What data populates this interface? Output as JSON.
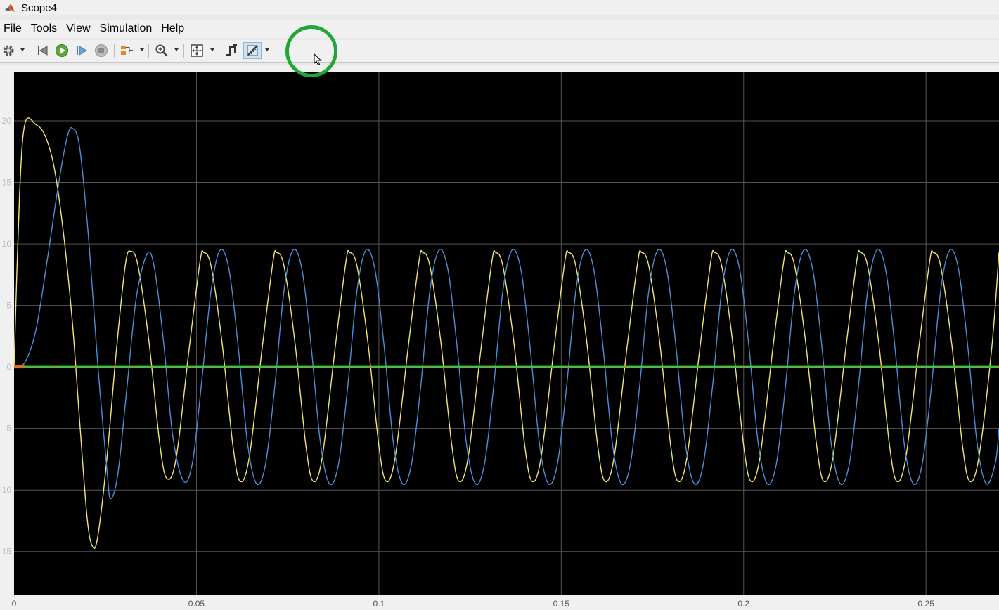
{
  "window": {
    "title": "Scope4"
  },
  "menu": [
    "File",
    "Tools",
    "View",
    "Simulation",
    "Help"
  ],
  "toolbar": {
    "buttons": [
      "settings",
      "step-back",
      "run",
      "step-forward",
      "stop",
      "signal-layout",
      "zoom",
      "fit-to-view",
      "triggers",
      "measurements"
    ]
  },
  "chart_data": {
    "type": "line",
    "background": "#000000",
    "grid": true,
    "xlim": [
      0,
      0.27
    ],
    "ylim": [
      -18.5,
      24
    ],
    "x_ticks": [
      0,
      0.05,
      0.1,
      0.15,
      0.2,
      0.25
    ],
    "x_tick_labels": [
      "0",
      "0.05",
      "0.1",
      "0.15",
      "0.2",
      "0.25"
    ],
    "y_ticks": [
      20,
      15,
      10,
      5,
      0,
      -5,
      -10,
      -15
    ],
    "y_tick_labels": [
      "20",
      "15",
      "10",
      "5",
      "0",
      "-5",
      "-10",
      "-15"
    ],
    "series": [
      {
        "color": "#f2e66e",
        "points": [
          [
            0,
            0
          ],
          [
            0.0015,
            14
          ],
          [
            0.003,
            19.8
          ],
          [
            0.006,
            19.7
          ],
          [
            0.0085,
            18.8
          ],
          [
            0.011,
            16.2
          ],
          [
            0.0135,
            11
          ],
          [
            0.016,
            3.6
          ],
          [
            0.018,
            -4.5
          ],
          [
            0.02,
            -12.2
          ],
          [
            0.0215,
            -14.6
          ],
          [
            0.023,
            -13.7
          ],
          [
            0.0255,
            -7.3
          ],
          [
            0.028,
            1.2
          ],
          [
            0.0305,
            8.3
          ],
          [
            0.032,
            9.4
          ],
          [
            0.034,
            8.2
          ],
          [
            0.037,
            2
          ],
          [
            0.04,
            -6.4
          ],
          [
            0.042,
            -9.1
          ],
          [
            0.0445,
            -7.3
          ],
          [
            0.048,
            1.5
          ],
          [
            0.051,
            8.6
          ],
          [
            0.052,
            9.3
          ],
          [
            0.054,
            8.2
          ],
          [
            0.057,
            2
          ],
          [
            0.06,
            -6.4
          ],
          [
            0.062,
            -9.3
          ],
          [
            0.0645,
            -7.3
          ],
          [
            0.068,
            1.5
          ],
          [
            0.071,
            8.6
          ],
          [
            0.072,
            9.3
          ],
          [
            0.074,
            8.2
          ],
          [
            0.077,
            2
          ],
          [
            0.08,
            -6.4
          ],
          [
            0.082,
            -9.3
          ],
          [
            0.0845,
            -7.3
          ],
          [
            0.088,
            1.5
          ],
          [
            0.091,
            8.6
          ],
          [
            0.092,
            9.3
          ],
          [
            0.094,
            8.2
          ],
          [
            0.097,
            2
          ],
          [
            0.1,
            -6.4
          ],
          [
            0.102,
            -9.3
          ],
          [
            0.1045,
            -7.3
          ],
          [
            0.108,
            1.5
          ],
          [
            0.111,
            8.6
          ],
          [
            0.112,
            9.3
          ],
          [
            0.114,
            8.2
          ],
          [
            0.117,
            2
          ],
          [
            0.12,
            -6.4
          ],
          [
            0.122,
            -9.3
          ],
          [
            0.1245,
            -7.3
          ],
          [
            0.128,
            1.5
          ],
          [
            0.131,
            8.6
          ],
          [
            0.132,
            9.3
          ],
          [
            0.134,
            8.2
          ],
          [
            0.137,
            2
          ],
          [
            0.14,
            -6.4
          ],
          [
            0.142,
            -9.3
          ],
          [
            0.1445,
            -7.3
          ],
          [
            0.148,
            1.5
          ],
          [
            0.151,
            8.6
          ],
          [
            0.152,
            9.3
          ],
          [
            0.154,
            8.2
          ],
          [
            0.157,
            2
          ],
          [
            0.16,
            -6.4
          ],
          [
            0.162,
            -9.3
          ],
          [
            0.1645,
            -7.3
          ],
          [
            0.168,
            1.5
          ],
          [
            0.171,
            8.6
          ],
          [
            0.172,
            9.3
          ],
          [
            0.174,
            8.2
          ],
          [
            0.177,
            2
          ],
          [
            0.18,
            -6.4
          ],
          [
            0.182,
            -9.3
          ],
          [
            0.1845,
            -7.3
          ],
          [
            0.188,
            1.5
          ],
          [
            0.191,
            8.6
          ],
          [
            0.192,
            9.3
          ],
          [
            0.194,
            8.2
          ],
          [
            0.197,
            2
          ],
          [
            0.2,
            -6.4
          ],
          [
            0.202,
            -9.3
          ],
          [
            0.2045,
            -7.3
          ],
          [
            0.208,
            1.5
          ],
          [
            0.211,
            8.6
          ],
          [
            0.212,
            9.3
          ],
          [
            0.214,
            8.2
          ],
          [
            0.217,
            2
          ],
          [
            0.22,
            -6.4
          ],
          [
            0.222,
            -9.3
          ],
          [
            0.2245,
            -7.3
          ],
          [
            0.228,
            1.5
          ],
          [
            0.231,
            8.6
          ],
          [
            0.232,
            9.3
          ],
          [
            0.234,
            8.2
          ],
          [
            0.237,
            2
          ],
          [
            0.24,
            -6.4
          ],
          [
            0.242,
            -9.3
          ],
          [
            0.2445,
            -7.3
          ],
          [
            0.248,
            1.5
          ],
          [
            0.251,
            8.6
          ],
          [
            0.252,
            9.3
          ],
          [
            0.254,
            8.2
          ],
          [
            0.257,
            2
          ],
          [
            0.26,
            -6.4
          ],
          [
            0.262,
            -9.3
          ],
          [
            0.2645,
            -7.3
          ],
          [
            0.268,
            1.5
          ],
          [
            0.27,
            9.3
          ]
        ]
      },
      {
        "color": "#4a8fd8",
        "points": [
          [
            0,
            0
          ],
          [
            0.003,
            0.4
          ],
          [
            0.006,
            3
          ],
          [
            0.009,
            8.5
          ],
          [
            0.012,
            14.5
          ],
          [
            0.0145,
            18.6
          ],
          [
            0.016,
            19.4
          ],
          [
            0.018,
            17.8
          ],
          [
            0.0205,
            10.2
          ],
          [
            0.023,
            0
          ],
          [
            0.0255,
            -8.5
          ],
          [
            0.0265,
            -10.7
          ],
          [
            0.0285,
            -8.6
          ],
          [
            0.031,
            -1.5
          ],
          [
            0.0335,
            5.6
          ],
          [
            0.0365,
            9.2
          ],
          [
            0.0385,
            8
          ],
          [
            0.041,
            2
          ],
          [
            0.0435,
            -5.6
          ],
          [
            0.0465,
            -9.3
          ],
          [
            0.049,
            -7.6
          ],
          [
            0.0515,
            -1
          ],
          [
            0.054,
            6.2
          ],
          [
            0.0565,
            9.5
          ],
          [
            0.059,
            7.8
          ],
          [
            0.0615,
            1.5
          ],
          [
            0.064,
            -6.2
          ],
          [
            0.0665,
            -9.5
          ],
          [
            0.069,
            -7.8
          ],
          [
            0.0715,
            -1.5
          ],
          [
            0.074,
            6.2
          ],
          [
            0.0765,
            9.5
          ],
          [
            0.079,
            7.8
          ],
          [
            0.0815,
            1.5
          ],
          [
            0.084,
            -6.2
          ],
          [
            0.0865,
            -9.5
          ],
          [
            0.089,
            -7.8
          ],
          [
            0.0915,
            -1.5
          ],
          [
            0.094,
            6.2
          ],
          [
            0.0965,
            9.5
          ],
          [
            0.099,
            7.8
          ],
          [
            0.1015,
            1.5
          ],
          [
            0.104,
            -6.2
          ],
          [
            0.1065,
            -9.5
          ],
          [
            0.109,
            -7.8
          ],
          [
            0.1115,
            -1.5
          ],
          [
            0.114,
            6.2
          ],
          [
            0.1165,
            9.5
          ],
          [
            0.119,
            7.8
          ],
          [
            0.1215,
            1.5
          ],
          [
            0.124,
            -6.2
          ],
          [
            0.1265,
            -9.5
          ],
          [
            0.129,
            -7.8
          ],
          [
            0.1315,
            -1.5
          ],
          [
            0.134,
            6.2
          ],
          [
            0.1365,
            9.5
          ],
          [
            0.139,
            7.8
          ],
          [
            0.1415,
            1.5
          ],
          [
            0.144,
            -6.2
          ],
          [
            0.1465,
            -9.5
          ],
          [
            0.149,
            -7.8
          ],
          [
            0.1515,
            -1.5
          ],
          [
            0.154,
            6.2
          ],
          [
            0.1565,
            9.5
          ],
          [
            0.159,
            7.8
          ],
          [
            0.1615,
            1.5
          ],
          [
            0.164,
            -6.2
          ],
          [
            0.1665,
            -9.5
          ],
          [
            0.169,
            -7.8
          ],
          [
            0.1715,
            -1.5
          ],
          [
            0.174,
            6.2
          ],
          [
            0.1765,
            9.5
          ],
          [
            0.179,
            7.8
          ],
          [
            0.1815,
            1.5
          ],
          [
            0.184,
            -6.2
          ],
          [
            0.1865,
            -9.5
          ],
          [
            0.189,
            -7.8
          ],
          [
            0.1915,
            -1.5
          ],
          [
            0.194,
            6.2
          ],
          [
            0.1965,
            9.5
          ],
          [
            0.199,
            7.8
          ],
          [
            0.2015,
            1.5
          ],
          [
            0.204,
            -6.2
          ],
          [
            0.2065,
            -9.5
          ],
          [
            0.209,
            -7.8
          ],
          [
            0.2115,
            -1.5
          ],
          [
            0.214,
            6.2
          ],
          [
            0.2165,
            9.5
          ],
          [
            0.219,
            7.8
          ],
          [
            0.2215,
            1.5
          ],
          [
            0.224,
            -6.2
          ],
          [
            0.2265,
            -9.5
          ],
          [
            0.229,
            -7.8
          ],
          [
            0.2315,
            -1.5
          ],
          [
            0.234,
            6.2
          ],
          [
            0.2365,
            9.5
          ],
          [
            0.239,
            7.8
          ],
          [
            0.2415,
            1.5
          ],
          [
            0.244,
            -6.2
          ],
          [
            0.2465,
            -9.5
          ],
          [
            0.249,
            -7.8
          ],
          [
            0.2515,
            -1.5
          ],
          [
            0.254,
            6.2
          ],
          [
            0.2565,
            9.5
          ],
          [
            0.259,
            7.8
          ],
          [
            0.2615,
            1.5
          ],
          [
            0.264,
            -6.2
          ],
          [
            0.2665,
            -9.5
          ],
          [
            0.269,
            -7.8
          ],
          [
            0.27,
            -5
          ]
        ]
      },
      {
        "color": "#44c044",
        "points": [
          [
            0,
            0
          ],
          [
            0.27,
            0
          ]
        ]
      },
      {
        "color": "#e07030",
        "points": [
          [
            0,
            0
          ],
          [
            0.003,
            0
          ]
        ]
      }
    ]
  }
}
